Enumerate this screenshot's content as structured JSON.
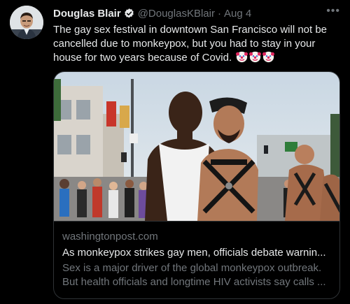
{
  "tweet": {
    "author_name": "Douglas Blair",
    "handle": "@DouglasKBlair",
    "separator": "·",
    "date": "Aug 4",
    "more": "•••",
    "text": "The gay sex festival in downtown San Francisco will not be cancelled due to monkeypox, but you had to stay in your house for two years because of Covid.",
    "emojis": [
      "clown-face-icon",
      "clown-face-icon",
      "clown-face-icon"
    ],
    "verified_color": "#1d9bf0"
  },
  "card": {
    "domain": "washingtonpost.com",
    "title": "As monkeypox strikes gay men, officials debate warnin...",
    "description": "Sex is a major driver of the global monkeypox outbreak. But health officials and longtime HIV activists say calls ..."
  }
}
